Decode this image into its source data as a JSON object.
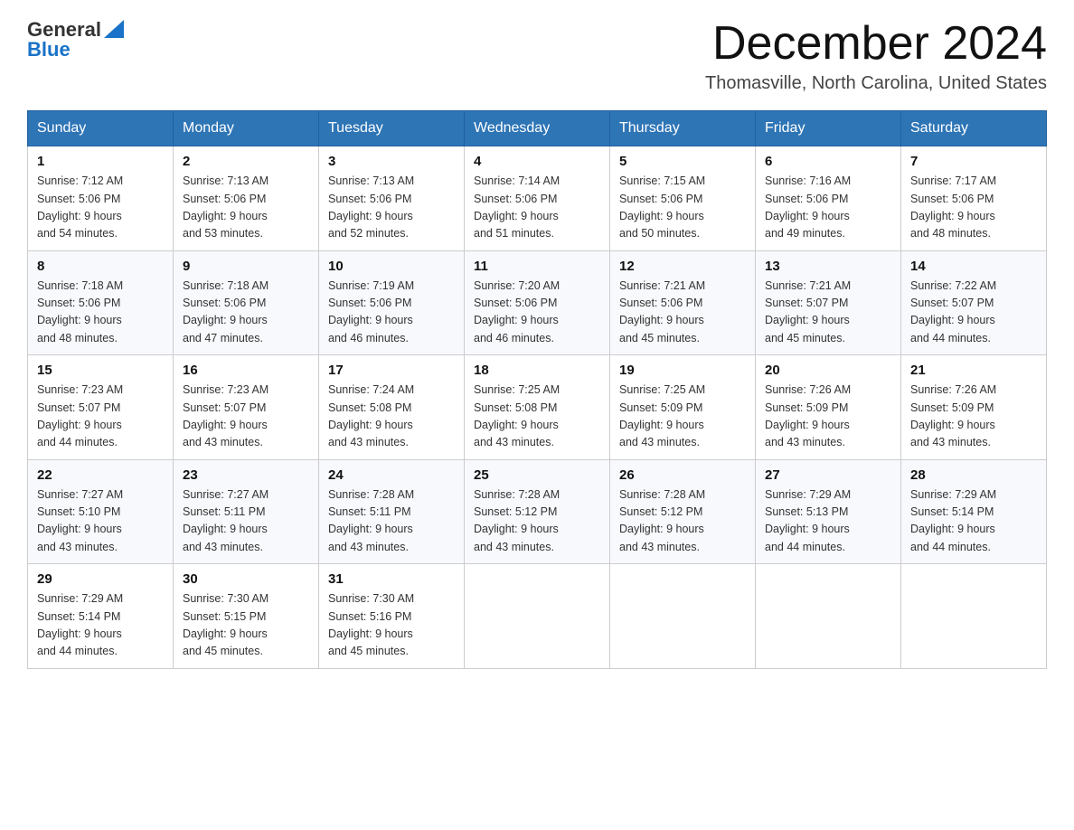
{
  "logo": {
    "general": "General",
    "blue": "Blue"
  },
  "title": "December 2024",
  "subtitle": "Thomasville, North Carolina, United States",
  "headers": [
    "Sunday",
    "Monday",
    "Tuesday",
    "Wednesday",
    "Thursday",
    "Friday",
    "Saturday"
  ],
  "weeks": [
    [
      {
        "day": "1",
        "sunrise": "7:12 AM",
        "sunset": "5:06 PM",
        "daylight": "9 hours and 54 minutes."
      },
      {
        "day": "2",
        "sunrise": "7:13 AM",
        "sunset": "5:06 PM",
        "daylight": "9 hours and 53 minutes."
      },
      {
        "day": "3",
        "sunrise": "7:13 AM",
        "sunset": "5:06 PM",
        "daylight": "9 hours and 52 minutes."
      },
      {
        "day": "4",
        "sunrise": "7:14 AM",
        "sunset": "5:06 PM",
        "daylight": "9 hours and 51 minutes."
      },
      {
        "day": "5",
        "sunrise": "7:15 AM",
        "sunset": "5:06 PM",
        "daylight": "9 hours and 50 minutes."
      },
      {
        "day": "6",
        "sunrise": "7:16 AM",
        "sunset": "5:06 PM",
        "daylight": "9 hours and 49 minutes."
      },
      {
        "day": "7",
        "sunrise": "7:17 AM",
        "sunset": "5:06 PM",
        "daylight": "9 hours and 48 minutes."
      }
    ],
    [
      {
        "day": "8",
        "sunrise": "7:18 AM",
        "sunset": "5:06 PM",
        "daylight": "9 hours and 48 minutes."
      },
      {
        "day": "9",
        "sunrise": "7:18 AM",
        "sunset": "5:06 PM",
        "daylight": "9 hours and 47 minutes."
      },
      {
        "day": "10",
        "sunrise": "7:19 AM",
        "sunset": "5:06 PM",
        "daylight": "9 hours and 46 minutes."
      },
      {
        "day": "11",
        "sunrise": "7:20 AM",
        "sunset": "5:06 PM",
        "daylight": "9 hours and 46 minutes."
      },
      {
        "day": "12",
        "sunrise": "7:21 AM",
        "sunset": "5:06 PM",
        "daylight": "9 hours and 45 minutes."
      },
      {
        "day": "13",
        "sunrise": "7:21 AM",
        "sunset": "5:07 PM",
        "daylight": "9 hours and 45 minutes."
      },
      {
        "day": "14",
        "sunrise": "7:22 AM",
        "sunset": "5:07 PM",
        "daylight": "9 hours and 44 minutes."
      }
    ],
    [
      {
        "day": "15",
        "sunrise": "7:23 AM",
        "sunset": "5:07 PM",
        "daylight": "9 hours and 44 minutes."
      },
      {
        "day": "16",
        "sunrise": "7:23 AM",
        "sunset": "5:07 PM",
        "daylight": "9 hours and 43 minutes."
      },
      {
        "day": "17",
        "sunrise": "7:24 AM",
        "sunset": "5:08 PM",
        "daylight": "9 hours and 43 minutes."
      },
      {
        "day": "18",
        "sunrise": "7:25 AM",
        "sunset": "5:08 PM",
        "daylight": "9 hours and 43 minutes."
      },
      {
        "day": "19",
        "sunrise": "7:25 AM",
        "sunset": "5:09 PM",
        "daylight": "9 hours and 43 minutes."
      },
      {
        "day": "20",
        "sunrise": "7:26 AM",
        "sunset": "5:09 PM",
        "daylight": "9 hours and 43 minutes."
      },
      {
        "day": "21",
        "sunrise": "7:26 AM",
        "sunset": "5:09 PM",
        "daylight": "9 hours and 43 minutes."
      }
    ],
    [
      {
        "day": "22",
        "sunrise": "7:27 AM",
        "sunset": "5:10 PM",
        "daylight": "9 hours and 43 minutes."
      },
      {
        "day": "23",
        "sunrise": "7:27 AM",
        "sunset": "5:11 PM",
        "daylight": "9 hours and 43 minutes."
      },
      {
        "day": "24",
        "sunrise": "7:28 AM",
        "sunset": "5:11 PM",
        "daylight": "9 hours and 43 minutes."
      },
      {
        "day": "25",
        "sunrise": "7:28 AM",
        "sunset": "5:12 PM",
        "daylight": "9 hours and 43 minutes."
      },
      {
        "day": "26",
        "sunrise": "7:28 AM",
        "sunset": "5:12 PM",
        "daylight": "9 hours and 43 minutes."
      },
      {
        "day": "27",
        "sunrise": "7:29 AM",
        "sunset": "5:13 PM",
        "daylight": "9 hours and 44 minutes."
      },
      {
        "day": "28",
        "sunrise": "7:29 AM",
        "sunset": "5:14 PM",
        "daylight": "9 hours and 44 minutes."
      }
    ],
    [
      {
        "day": "29",
        "sunrise": "7:29 AM",
        "sunset": "5:14 PM",
        "daylight": "9 hours and 44 minutes."
      },
      {
        "day": "30",
        "sunrise": "7:30 AM",
        "sunset": "5:15 PM",
        "daylight": "9 hours and 45 minutes."
      },
      {
        "day": "31",
        "sunrise": "7:30 AM",
        "sunset": "5:16 PM",
        "daylight": "9 hours and 45 minutes."
      },
      null,
      null,
      null,
      null
    ]
  ],
  "labels": {
    "sunrise": "Sunrise:",
    "sunset": "Sunset:",
    "daylight": "Daylight:"
  }
}
